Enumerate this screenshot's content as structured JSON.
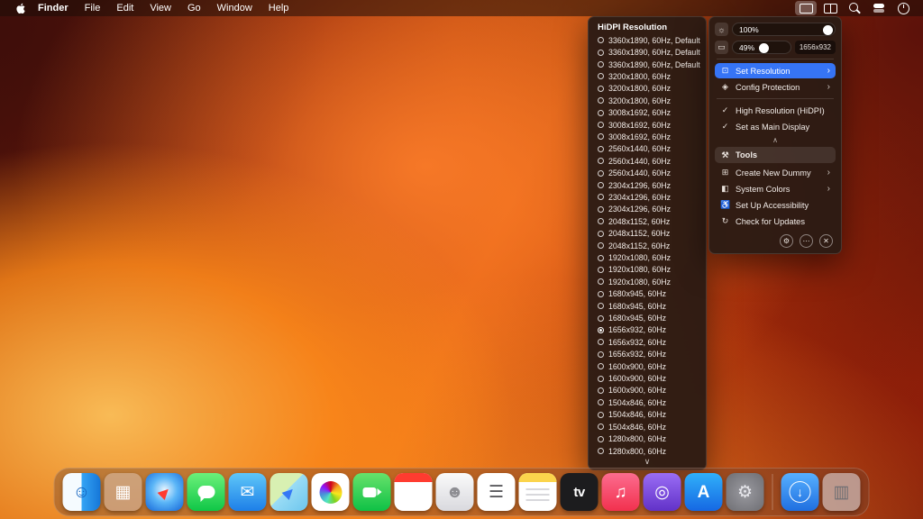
{
  "menubar": {
    "items": [
      {
        "label": "Finder",
        "cls": "bold"
      },
      {
        "label": "File"
      },
      {
        "label": "Edit"
      },
      {
        "label": "View"
      },
      {
        "label": "Go"
      },
      {
        "label": "Window"
      },
      {
        "label": "Help"
      }
    ],
    "status_icons": [
      {
        "name": "display-icon",
        "selected": true
      },
      {
        "name": "window-grid-icon"
      },
      {
        "name": "search-icon"
      },
      {
        "name": "control-center-icon"
      },
      {
        "name": "clock-icon"
      }
    ]
  },
  "resolution_panel": {
    "title": "HiDPI Resolution",
    "more_glyph": "∨",
    "items": [
      {
        "label": "3360x1890, 60Hz, Default"
      },
      {
        "label": "3360x1890, 60Hz, Default"
      },
      {
        "label": "3360x1890, 60Hz, Default"
      },
      {
        "label": "3200x1800, 60Hz"
      },
      {
        "label": "3200x1800, 60Hz"
      },
      {
        "label": "3200x1800, 60Hz"
      },
      {
        "label": "3008x1692, 60Hz"
      },
      {
        "label": "3008x1692, 60Hz"
      },
      {
        "label": "3008x1692, 60Hz"
      },
      {
        "label": "2560x1440, 60Hz"
      },
      {
        "label": "2560x1440, 60Hz"
      },
      {
        "label": "2560x1440, 60Hz"
      },
      {
        "label": "2304x1296, 60Hz"
      },
      {
        "label": "2304x1296, 60Hz"
      },
      {
        "label": "2304x1296, 60Hz"
      },
      {
        "label": "2048x1152, 60Hz"
      },
      {
        "label": "2048x1152, 60Hz"
      },
      {
        "label": "2048x1152, 60Hz"
      },
      {
        "label": "1920x1080, 60Hz"
      },
      {
        "label": "1920x1080, 60Hz"
      },
      {
        "label": "1920x1080, 60Hz"
      },
      {
        "label": "1680x945, 60Hz"
      },
      {
        "label": "1680x945, 60Hz"
      },
      {
        "label": "1680x945, 60Hz"
      },
      {
        "label": "1656x932, 60Hz",
        "selected": true
      },
      {
        "label": "1656x932, 60Hz"
      },
      {
        "label": "1656x932, 60Hz"
      },
      {
        "label": "1600x900, 60Hz"
      },
      {
        "label": "1600x900, 60Hz"
      },
      {
        "label": "1600x900, 60Hz"
      },
      {
        "label": "1504x846, 60Hz"
      },
      {
        "label": "1504x846, 60Hz"
      },
      {
        "label": "1504x846, 60Hz"
      },
      {
        "label": "1280x800, 60Hz"
      },
      {
        "label": "1280x800, 60Hz"
      }
    ]
  },
  "control_panel": {
    "sliders": [
      {
        "icon": "brightness-icon",
        "glyph": "☼",
        "label": "100%",
        "knob_style": "left:calc(100% - 13px)"
      },
      {
        "icon": "scale-icon",
        "glyph": "▭",
        "label": "49%",
        "knob_style": "left:46%",
        "badge": "1656x932"
      }
    ],
    "menu_items": [
      {
        "icon": "display-icon",
        "glyph": "⊡",
        "label": "Set Resolution",
        "chevron": "›",
        "selected": true
      },
      {
        "icon": "shield-icon",
        "glyph": "◈",
        "label": "Config Protection",
        "chevron": "›"
      }
    ],
    "toggle_items": [
      {
        "icon": "check-circle-icon",
        "glyph": "✓",
        "label": "High Resolution (HiDPI)"
      },
      {
        "icon": "check-circle-icon",
        "glyph": "✓",
        "label": "Set as Main Display"
      }
    ],
    "collapse_glyph": "∧",
    "tools": {
      "header": "Tools",
      "header_glyph": "⚒",
      "items": [
        {
          "icon": "plus-icon",
          "glyph": "⊞",
          "label": "Create New Dummy",
          "chevron": "›"
        },
        {
          "icon": "colors-icon",
          "glyph": "◧",
          "label": "System Colors",
          "chevron": "›"
        },
        {
          "icon": "accessibility-icon",
          "glyph": "♿",
          "label": "Set Up Accessibility"
        },
        {
          "icon": "update-icon",
          "glyph": "↻",
          "label": "Check for Updates"
        }
      ]
    },
    "footer_buttons": [
      {
        "name": "settings-button",
        "glyph": "⚙"
      },
      {
        "name": "more-button",
        "glyph": "⋯"
      },
      {
        "name": "quit-button",
        "glyph": "✕"
      }
    ]
  },
  "dock": {
    "apps": [
      {
        "name": "Finder",
        "icon_name": "finder-icon",
        "glyph": "☺",
        "fg": "#1565c0",
        "bg": "linear-gradient(90deg,#f5fbff 0%,#f5fbff 50%,#35a5f5 50%,#1576d8 100%)"
      },
      {
        "name": "Launchpad",
        "icon_name": "launchpad-icon",
        "glyph": "▦",
        "fg": "#ffffff",
        "bg": "rgba(235,235,245,0.35)"
      },
      {
        "name": "Safari",
        "icon_name": "safari-icon",
        "glyph": "▶",
        "fg": "#ff3b30",
        "cls": "safari",
        "bg": "radial-gradient(circle at 50% 45%,#eaf6ff 0%,#5ab5f7 45%,#1465d8 100%)"
      },
      {
        "name": "Messages",
        "icon_name": "messages-icon",
        "glyph": "",
        "cls": "bubble",
        "bg": "linear-gradient(180deg,#6cf07a,#0fc747)"
      },
      {
        "name": "Mail",
        "icon_name": "mail-icon",
        "glyph": "✉",
        "fg": "#ffffff",
        "bg": "linear-gradient(180deg,#5fc7f8,#1d7fe8)"
      },
      {
        "name": "Maps",
        "icon_name": "maps-icon",
        "glyph": "▶",
        "fg": "#3478f6",
        "cls": "maps",
        "bg": "linear-gradient(135deg,#d8f0b2 0%,#d8f0b2 45%,#9adcf5 45%,#6cc6ee 100%)"
      },
      {
        "name": "Photos",
        "icon_name": "photos-icon",
        "glyph": "",
        "cls": "photos",
        "bg": "#ffffff"
      },
      {
        "name": "FaceTime",
        "icon_name": "facetime-icon",
        "glyph": "",
        "cls": "facetime",
        "bg": "linear-gradient(180deg,#67e26b,#0fc146)"
      },
      {
        "name": "Calendar",
        "icon_name": "calendar-icon",
        "glyph": "",
        "cls": "calendar",
        "bg": "#ffffff"
      },
      {
        "name": "Contacts",
        "icon_name": "contacts-icon",
        "glyph": "☻",
        "fg": "#8e8e93",
        "bg": "linear-gradient(180deg,#fafafa,#d9d9de)"
      },
      {
        "name": "Reminders",
        "icon_name": "reminders-icon",
        "glyph": "☰",
        "fg": "#5a5a5e",
        "bg": "#ffffff"
      },
      {
        "name": "Notes",
        "icon_name": "notes-icon",
        "glyph": "",
        "cls": "notes",
        "bg": "#ffffff"
      },
      {
        "name": "TV",
        "icon_name": "tv-icon",
        "glyph": "tv",
        "fg": "#ffffff",
        "cls": "tv",
        "bg": "#1c1c1e"
      },
      {
        "name": "Music",
        "icon_name": "music-icon",
        "glyph": "♫",
        "fg": "#ffffff",
        "bg": "linear-gradient(180deg,#fc6c8f,#f2314e)"
      },
      {
        "name": "Podcasts",
        "icon_name": "podcasts-icon",
        "glyph": "◎",
        "fg": "#ffffff",
        "bg": "linear-gradient(180deg,#9a6df5,#6232c8)"
      },
      {
        "name": "App Store",
        "icon_name": "app-store-icon",
        "glyph": "A",
        "fg": "#ffffff",
        "cls": "appstore",
        "bg": "linear-gradient(180deg,#30b0fa,#1668e3)"
      },
      {
        "name": "System Settings",
        "icon_name": "system-settings-icon",
        "glyph": "⚙",
        "fg": "#e8e8ed",
        "bg": "radial-gradient(circle,#9a9aa0 0%,#6e6e73 100%)"
      }
    ],
    "end_items": [
      {
        "name": "Downloads",
        "icon_name": "downloads-icon",
        "glyph": "↓",
        "fg": "#ffffff",
        "cls": "downloads",
        "bg": "linear-gradient(180deg,#57b0ff,#1f6fe0)"
      },
      {
        "name": "Trash",
        "icon_name": "trash-icon",
        "glyph": "▥",
        "fg": "#6e6e73",
        "bg": "rgba(225,228,235,0.55)"
      }
    ]
  }
}
